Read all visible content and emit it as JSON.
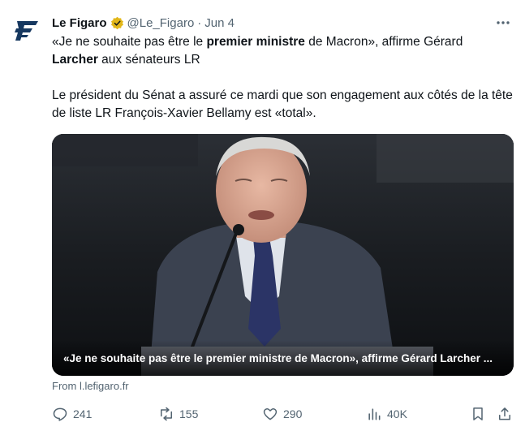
{
  "account": {
    "name": "Le Figaro",
    "handle": "@Le_Figaro",
    "separator": "·",
    "date": "Jun 4"
  },
  "tweet": {
    "line1_a": "«Je ne souhaite pas être le ",
    "line1_bold": "premier ministre",
    "line1_b": " de Macron», affirme Gérard",
    "line2_bold": "Larcher",
    "line2_b": " aux sénateurs LR",
    "paragraph2": "Le président du Sénat a assuré ce mardi que son engagement aux côtés de la tête de liste LR François-Xavier Bellamy est «total»."
  },
  "card": {
    "caption": "«Je ne souhaite pas être le premier ministre de Macron», affirme Gérard Larcher ...",
    "source": "From l.lefigaro.fr"
  },
  "actions": {
    "replies": "241",
    "reposts": "155",
    "likes": "290",
    "views": "40K"
  },
  "colors": {
    "verified_badge": "#e2b719",
    "logo_blue": "#163860",
    "muted": "#536471"
  },
  "icons": {
    "avatar": "le-figaro-logo",
    "verified": "verified-badge-icon",
    "more": "more-icon",
    "reply": "reply-icon",
    "repost": "repost-icon",
    "like": "like-icon",
    "views": "views-icon",
    "bookmark": "bookmark-icon",
    "share": "share-icon"
  }
}
